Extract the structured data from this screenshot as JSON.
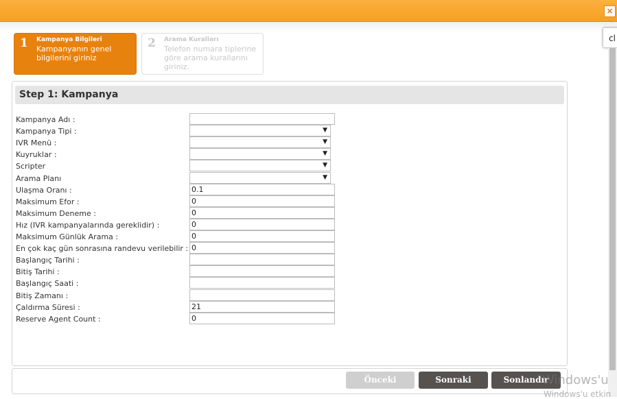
{
  "header": {
    "close_label": "×"
  },
  "side_tab": {
    "label": "cl"
  },
  "wizard": {
    "steps": [
      {
        "num": "1",
        "title": "Kampanya Bilgileri",
        "desc": "Kampanyanın genel bilgilerini giriniz"
      },
      {
        "num": "2",
        "title": "Arama Kuralları",
        "desc": "Telefon numara tiplerine göre arama kurallarını giriniz."
      }
    ]
  },
  "panel": {
    "title": "Step 1: Kampanya",
    "fields": [
      {
        "label": "Kampanya Adı :",
        "type": "text",
        "value": ""
      },
      {
        "label": "Kampanya Tipi :",
        "type": "select",
        "value": ""
      },
      {
        "label": "IVR Menü :",
        "type": "select",
        "value": ""
      },
      {
        "label": "Kuyruklar :",
        "type": "select",
        "value": ""
      },
      {
        "label": "Scripter",
        "type": "select",
        "value": ""
      },
      {
        "label": "Arama Planı",
        "type": "select",
        "value": ""
      },
      {
        "label": "Ulaşma Oranı :",
        "type": "text",
        "value": "0.1"
      },
      {
        "label": "Maksimum Efor :",
        "type": "text",
        "value": "0"
      },
      {
        "label": "Maksimum Deneme :",
        "type": "text",
        "value": "0"
      },
      {
        "label": "Hız (IVR kampanyalarında gereklidir) :",
        "type": "text",
        "value": "0"
      },
      {
        "label": "Maksimum Günlük Arama :",
        "type": "text",
        "value": "0"
      },
      {
        "label": "En çok kaç gün sonrasına randevu verilebilir :",
        "type": "text",
        "value": "0"
      },
      {
        "label": "Başlangıç Tarihi :",
        "type": "text",
        "value": ""
      },
      {
        "label": "Bitiş Tarihi :",
        "type": "text",
        "value": ""
      },
      {
        "label": "Başlangıç Saati :",
        "type": "text",
        "value": ""
      },
      {
        "label": "Bitiş Zamanı :",
        "type": "text",
        "value": ""
      },
      {
        "label": "Çaldırma Süresi :",
        "type": "text",
        "value": "21"
      },
      {
        "label": "Reserve Agent Count :",
        "type": "text",
        "value": "0"
      }
    ],
    "select_arrow": "▼"
  },
  "footer": {
    "prev_label": "Önceki",
    "next_label": "Sonraki",
    "finish_label": "Sonlandır"
  },
  "watermark": {
    "line1": "Windows'u",
    "line2": "Windows'u etkin"
  }
}
